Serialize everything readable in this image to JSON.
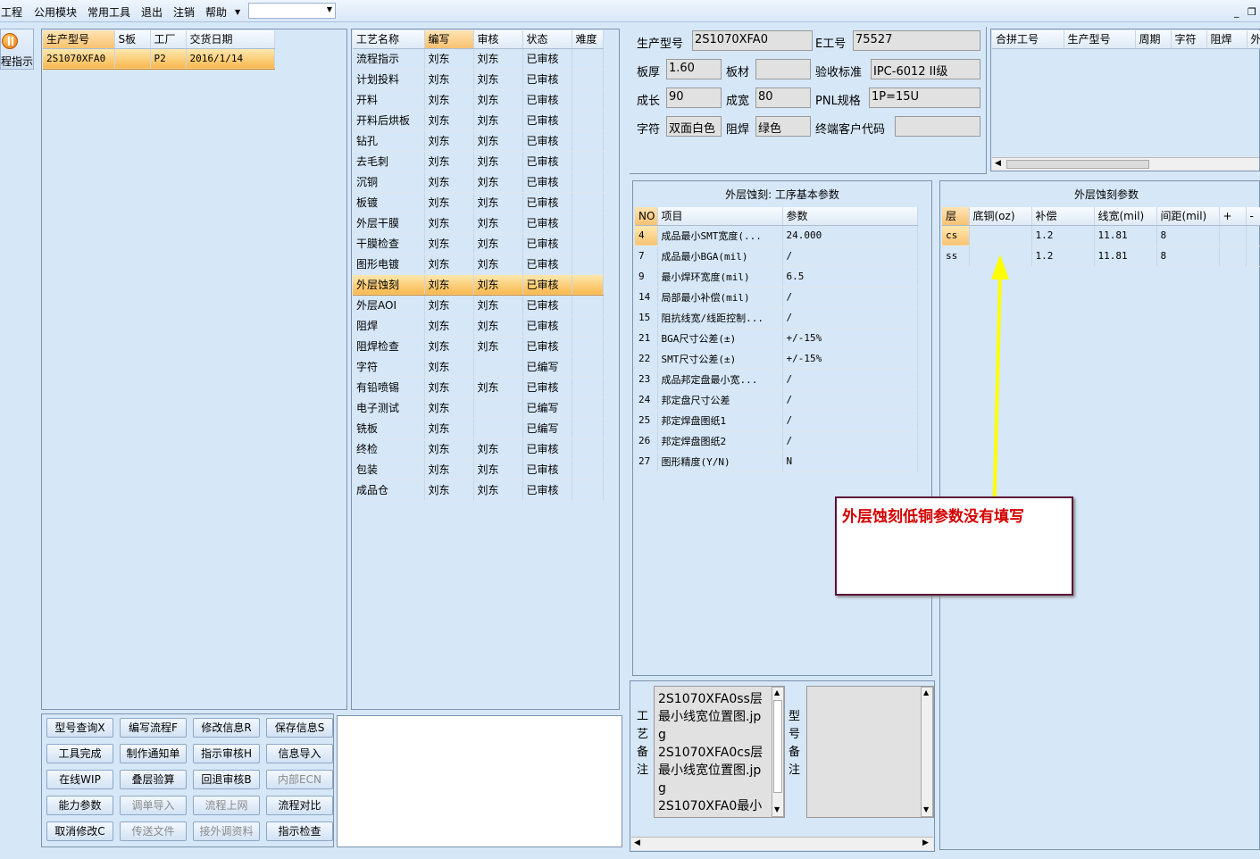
{
  "menu": {
    "items": [
      "工程",
      "公用模块",
      "常用工具",
      "退出",
      "注销",
      "帮助"
    ],
    "combo_value": ""
  },
  "left_strip": {
    "label": "程指示"
  },
  "orders": {
    "headers": [
      "生产型号",
      "S板",
      "工厂",
      "交货日期"
    ],
    "rows": [
      [
        "2S1070XFA0",
        "",
        "P2",
        "2016/1/14"
      ]
    ]
  },
  "process": {
    "headers": [
      "工艺名称",
      "编写",
      "审核",
      "状态",
      "难度"
    ],
    "rows": [
      [
        "流程指示",
        "刘东",
        "刘东",
        "已审核",
        ""
      ],
      [
        "计划投料",
        "刘东",
        "刘东",
        "已审核",
        ""
      ],
      [
        "开料",
        "刘东",
        "刘东",
        "已审核",
        ""
      ],
      [
        "开料后烘板",
        "刘东",
        "刘东",
        "已审核",
        ""
      ],
      [
        "钻孔",
        "刘东",
        "刘东",
        "已审核",
        ""
      ],
      [
        "去毛刺",
        "刘东",
        "刘东",
        "已审核",
        ""
      ],
      [
        "沉铜",
        "刘东",
        "刘东",
        "已审核",
        ""
      ],
      [
        "板镀",
        "刘东",
        "刘东",
        "已审核",
        ""
      ],
      [
        "外层干膜",
        "刘东",
        "刘东",
        "已审核",
        ""
      ],
      [
        "干膜检查",
        "刘东",
        "刘东",
        "已审核",
        ""
      ],
      [
        "图形电镀",
        "刘东",
        "刘东",
        "已审核",
        ""
      ],
      [
        "外层蚀刻",
        "刘东",
        "刘东",
        "已审核",
        ""
      ],
      [
        "外层AOI",
        "刘东",
        "刘东",
        "已审核",
        ""
      ],
      [
        "阻焊",
        "刘东",
        "刘东",
        "已审核",
        ""
      ],
      [
        "阻焊检查",
        "刘东",
        "刘东",
        "已审核",
        ""
      ],
      [
        "字符",
        "刘东",
        "",
        "已编写",
        ""
      ],
      [
        "有铅喷锡",
        "刘东",
        "刘东",
        "已审核",
        ""
      ],
      [
        "电子测试",
        "刘东",
        "",
        "已编写",
        ""
      ],
      [
        "铣板",
        "刘东",
        "",
        "已编写",
        ""
      ],
      [
        "终检",
        "刘东",
        "刘东",
        "已审核",
        ""
      ],
      [
        "包装",
        "刘东",
        "刘东",
        "已审核",
        ""
      ],
      [
        "成品仓",
        "刘东",
        "刘东",
        "已审核",
        ""
      ]
    ],
    "selected_row": 11
  },
  "buttons": [
    {
      "label": "型号查询X",
      "enabled": true
    },
    {
      "label": "编写流程F",
      "enabled": true
    },
    {
      "label": "修改信息R",
      "enabled": true
    },
    {
      "label": "保存信息S",
      "enabled": true
    },
    {
      "label": "工具完成",
      "enabled": true
    },
    {
      "label": "制作通知单",
      "enabled": true
    },
    {
      "label": "指示审核H",
      "enabled": true
    },
    {
      "label": "信息导入",
      "enabled": true
    },
    {
      "label": "在线WIP",
      "enabled": true
    },
    {
      "label": "叠层验算",
      "enabled": true
    },
    {
      "label": "回退审核B",
      "enabled": true
    },
    {
      "label": "内部ECN",
      "enabled": false
    },
    {
      "label": "能力参数",
      "enabled": true
    },
    {
      "label": "调单导入",
      "enabled": false
    },
    {
      "label": "流程上网",
      "enabled": false
    },
    {
      "label": "流程对比",
      "enabled": true
    },
    {
      "label": "取消修改C",
      "enabled": true
    },
    {
      "label": "传送文件",
      "enabled": false
    },
    {
      "label": "接外调资料",
      "enabled": false
    },
    {
      "label": "指示检查",
      "enabled": true
    }
  ],
  "info": {
    "prod_model_label": "生产型号",
    "prod_model": "2S1070XFA0",
    "e_no_label": "E工号",
    "e_no": "75527",
    "thickness_label": "板厚",
    "thickness": "1.60",
    "material_label": "板材",
    "material": "",
    "accept_std_label": "验收标准",
    "accept_std": "IPC-6012 II级",
    "length_label": "成长",
    "length": "90",
    "width_label": "成宽",
    "width": "80",
    "pnl_label": "PNL规格",
    "pnl": "1P=15U",
    "char_label": "字符",
    "char": "双面白色",
    "mask_label": "阻焊",
    "mask": "绿色",
    "customer_label": "终端客户代码",
    "customer": ""
  },
  "combine": {
    "headers": [
      "合拼工号",
      "生产型号",
      "周期",
      "字符",
      "阻焊",
      "外"
    ]
  },
  "base_params": {
    "title": "外层蚀刻: 工序基本参数",
    "headers": [
      "NO",
      "项目",
      "参数"
    ],
    "rows": [
      [
        "4",
        "成品最小SMT宽度(...",
        "24.000"
      ],
      [
        "7",
        "成品最小BGA(mil)",
        "/"
      ],
      [
        "9",
        "最小焊环宽度(mil)",
        "6.5"
      ],
      [
        "14",
        "局部最小补偿(mil)",
        "/"
      ],
      [
        "15",
        "阻抗线宽/线距控制...",
        "/"
      ],
      [
        "21",
        "BGA尺寸公差(±)",
        "+/-15%"
      ],
      [
        "22",
        "SMT尺寸公差(±)",
        "+/-15%"
      ],
      [
        "23",
        "成品邦定盘最小宽...",
        "/"
      ],
      [
        "24",
        "邦定盘尺寸公差",
        "/"
      ],
      [
        "25",
        "邦定焊盘图纸1",
        "/"
      ],
      [
        "26",
        "邦定焊盘图纸2",
        "/"
      ],
      [
        "27",
        "图形精度(Y/N)",
        "N"
      ]
    ]
  },
  "etch_params": {
    "title": "外层蚀刻参数",
    "headers": [
      "层",
      "底铜(oz)",
      "补偿",
      "线宽(mil)",
      "间距(mil)",
      "+",
      "-"
    ],
    "rows": [
      [
        "cs",
        "",
        "1.2",
        "11.81",
        "8",
        "",
        ""
      ],
      [
        "ss",
        "",
        "1.2",
        "11.81",
        "8",
        "",
        ""
      ]
    ]
  },
  "remarks": {
    "process_label": "工艺备注",
    "process_text": "2S1070XFA0ss层最小线宽位置图.jpg\n2S1070XFA0cs层最小线宽位置图.jpg\n2S1070XFA0最小",
    "model_label": "型号备注",
    "model_text": ""
  },
  "annotation": {
    "text": "外层蚀刻低铜参数没有填写",
    "color": "#d40000",
    "arrow_color": "#ffff00"
  },
  "colors": {
    "background": "#d6e7f7",
    "selection": "#f8b84e",
    "border": "#7d93ad"
  }
}
